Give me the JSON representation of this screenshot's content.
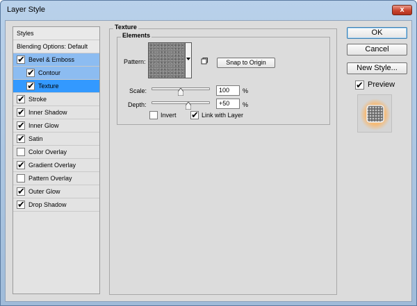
{
  "window": {
    "title": "Layer Style",
    "close_glyph": "x"
  },
  "styles_panel": {
    "header": "Styles",
    "blending_options": "Blending Options: Default",
    "items": [
      {
        "label": "Bevel & Emboss",
        "checked": true,
        "selected": "light"
      },
      {
        "label": "Contour",
        "checked": true,
        "selected": "light",
        "indent": true
      },
      {
        "label": "Texture",
        "checked": true,
        "selected": "dark",
        "indent": true
      },
      {
        "label": "Stroke",
        "checked": true
      },
      {
        "label": "Inner Shadow",
        "checked": true
      },
      {
        "label": "Inner Glow",
        "checked": true
      },
      {
        "label": "Satin",
        "checked": true
      },
      {
        "label": "Color Overlay",
        "checked": false
      },
      {
        "label": "Gradient Overlay",
        "checked": true
      },
      {
        "label": "Pattern Overlay",
        "checked": false
      },
      {
        "label": "Outer Glow",
        "checked": true
      },
      {
        "label": "Drop Shadow",
        "checked": true
      }
    ]
  },
  "texture": {
    "group_title": "Texture",
    "elements_title": "Elements",
    "pattern_label": "Pattern:",
    "snap_button": "Snap to Origin",
    "scale_label": "Scale:",
    "scale_value": "100",
    "scale_unit": "%",
    "scale_slider_fraction": 0.5,
    "depth_label": "Depth:",
    "depth_value": "+50",
    "depth_unit": "%",
    "depth_slider_fraction": 0.625,
    "invert_label": "Invert",
    "invert_checked": false,
    "link_label": "Link with Layer",
    "link_checked": true
  },
  "buttons": {
    "ok": "OK",
    "cancel": "Cancel",
    "new_style": "New Style...",
    "preview_label": "Preview",
    "preview_checked": true
  },
  "colors": {
    "selected_light": "#8cbcf1",
    "selected_dark": "#3399ff",
    "preview_glow": "#ffb25a"
  },
  "icons": {
    "close": "close-icon",
    "dropdown": "chevron-down-icon",
    "new_preset": "new-preset-icon",
    "check": "checkmark-icon"
  }
}
